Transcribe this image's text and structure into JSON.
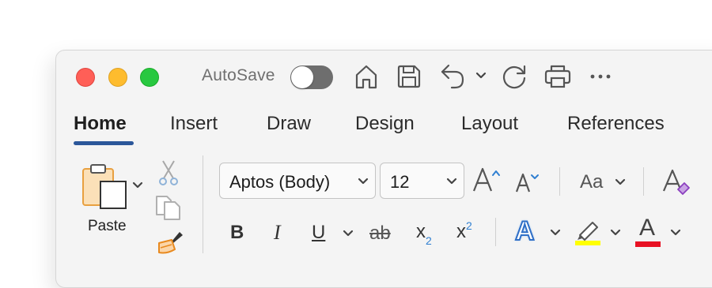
{
  "titlebar": {
    "autosave_label": "AutoSave",
    "autosave_on": false,
    "icons": [
      "home-icon",
      "save-icon",
      "undo-icon",
      "undo-dropdown-icon",
      "redo-icon",
      "print-icon",
      "more-icon"
    ]
  },
  "tabs": [
    {
      "label": "Home",
      "active": true
    },
    {
      "label": "Insert",
      "active": false
    },
    {
      "label": "Draw",
      "active": false
    },
    {
      "label": "Design",
      "active": false
    },
    {
      "label": "Layout",
      "active": false
    },
    {
      "label": "References",
      "active": false
    }
  ],
  "clipboard": {
    "paste_label": "Paste",
    "icons": [
      "clipboard-icon",
      "cut-icon",
      "copy-icon",
      "format-painter-icon"
    ]
  },
  "font": {
    "font_name": "Aptos (Body)",
    "font_size": "12",
    "change_case_label": "Aa",
    "icons": [
      "grow-font-icon",
      "shrink-font-icon",
      "change-case-icon",
      "clear-formatting-icon"
    ]
  },
  "format": {
    "bold": "B",
    "italic": "I",
    "underline": "U",
    "strikethrough": "ab",
    "subscript_base": "x",
    "subscript_mark": "2",
    "superscript_base": "x",
    "superscript_mark": "2",
    "text_effects": "A",
    "font_color_letter": "A"
  },
  "colors": {
    "highlight": "#ffff00",
    "font_color": "#e81123",
    "accent": "#2b579a",
    "sub_sup_mark": "#2f7fd1"
  }
}
